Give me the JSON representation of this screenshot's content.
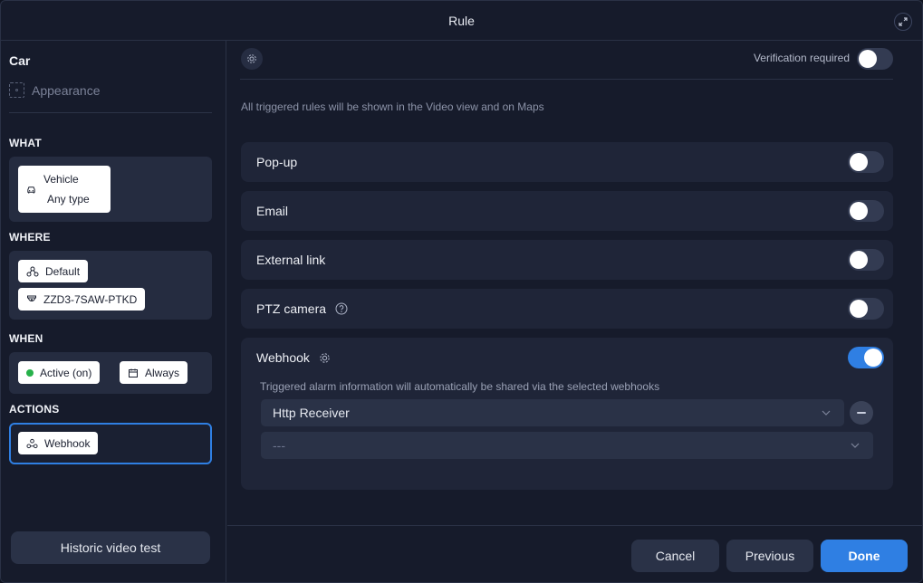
{
  "window": {
    "title": "Rule"
  },
  "sidebar": {
    "object": "Car",
    "appearance": "Appearance",
    "sections": {
      "what": {
        "label": "WHAT",
        "chip": {
          "line1": "Vehicle",
          "line2": "Any type"
        }
      },
      "where": {
        "label": "WHERE",
        "chips": [
          "Default",
          "ZZD3-7SAW-PTKD"
        ]
      },
      "when": {
        "label": "WHEN",
        "chips": [
          "Active (on)",
          "Always"
        ]
      },
      "actions": {
        "label": "ACTIONS",
        "chip": "Webhook"
      }
    },
    "historic_button": "Historic video test"
  },
  "main": {
    "verification_label": "Verification required",
    "verification_on": false,
    "info": "All triggered rules will be shown in the Video view and on Maps",
    "actions": [
      {
        "label": "Pop-up",
        "on": false
      },
      {
        "label": "Email",
        "on": false
      },
      {
        "label": "External link",
        "on": false
      },
      {
        "label": "PTZ camera",
        "on": false,
        "help_icon": "question-circle-icon"
      }
    ],
    "webhook": {
      "label": "Webhook",
      "on": true,
      "description": "Triggered alarm information will automatically be shared via the selected webhooks",
      "selected_receiver": "Http Receiver",
      "empty_select": "---"
    }
  },
  "footer": {
    "cancel": "Cancel",
    "previous": "Previous",
    "done": "Done"
  },
  "colors": {
    "accent": "#2f7fe3",
    "active_dot": "#27b14a",
    "panel": "#1f2538",
    "background": "#161b2b"
  }
}
